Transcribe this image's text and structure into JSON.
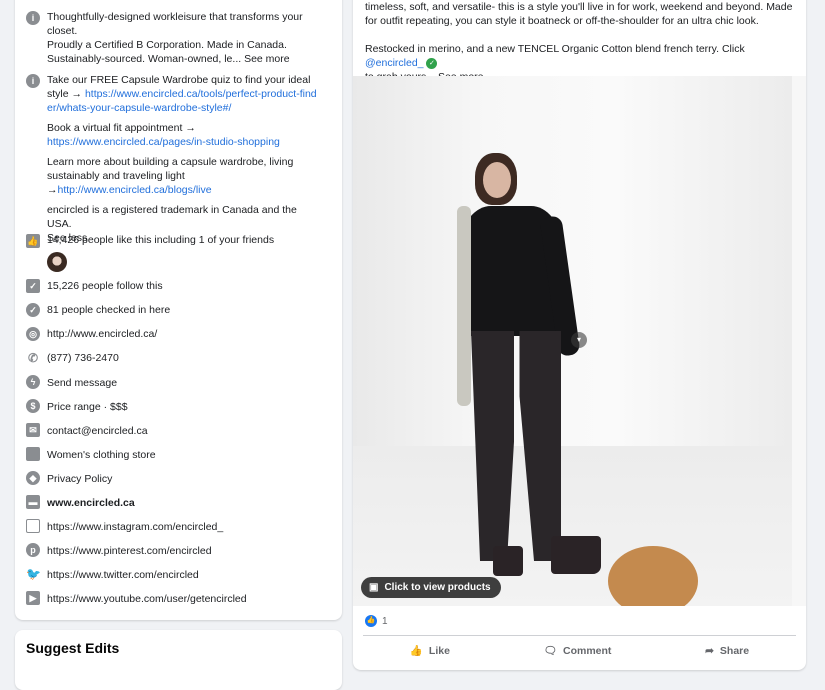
{
  "about": {
    "intro": [
      "Thoughtfully-designed workleisure that transforms your closet.",
      "Proudly a Certified B Corporation. Made in Canada.",
      "Sustainably-sourced. Woman-owned, le..."
    ],
    "see_more": "See more",
    "quiz_text": "Take our FREE Capsule Wardrobe quiz to find your ideal style →",
    "quiz_link": "https://www.encircled.ca/tools/perfect-product-finder/whats-your-capsule-wardrobe-style#/",
    "fit_text": "Book a virtual fit appointment →",
    "fit_link": "https://www.encircled.ca/pages/in-studio-shopping",
    "learn_text": "Learn more about building a capsule wardrobe, living sustainably and traveling light →",
    "learn_link": "http://www.encircled.ca/blogs/live",
    "trademark": "encircled is a registered trademark in Canada and the USA.",
    "see_less": "See less",
    "likes": "14,426 people like this including 1 of your friends",
    "follows": "15,226 people follow this",
    "checkins": "81 people checked in here",
    "website": "http://www.encircled.ca/",
    "phone": "(877) 736-2470",
    "message": "Send message",
    "price": "Price range · $$$",
    "email": "contact@encircled.ca",
    "category": "Women's clothing store",
    "privacy": "Privacy Policy",
    "shop": "www.encircled.ca",
    "instagram": "https://www.instagram.com/encircled_",
    "pinterest": "https://www.pinterest.com/encircled",
    "twitter": "https://www.twitter.com/encircled",
    "youtube": "https://www.youtube.com/user/getencircled"
  },
  "suggest": {
    "title": "Suggest Edits"
  },
  "post": {
    "line1": "timeless, soft, and versatile- this is a style you'll live in for work, weekend and beyond. Made for outfit repeating, you can style it boatneck or off-the-shoulder for an ultra chic look.",
    "line2": "Restocked in merino, and a new TENCEL Organic Cotton blend french terry. Click",
    "mention": "@encircled_",
    "line3": "to grab yours...",
    "see_more": "See more",
    "products_label": "Click to view products",
    "reaction_count": "1",
    "like": "Like",
    "comment": "Comment",
    "share": "Share"
  }
}
